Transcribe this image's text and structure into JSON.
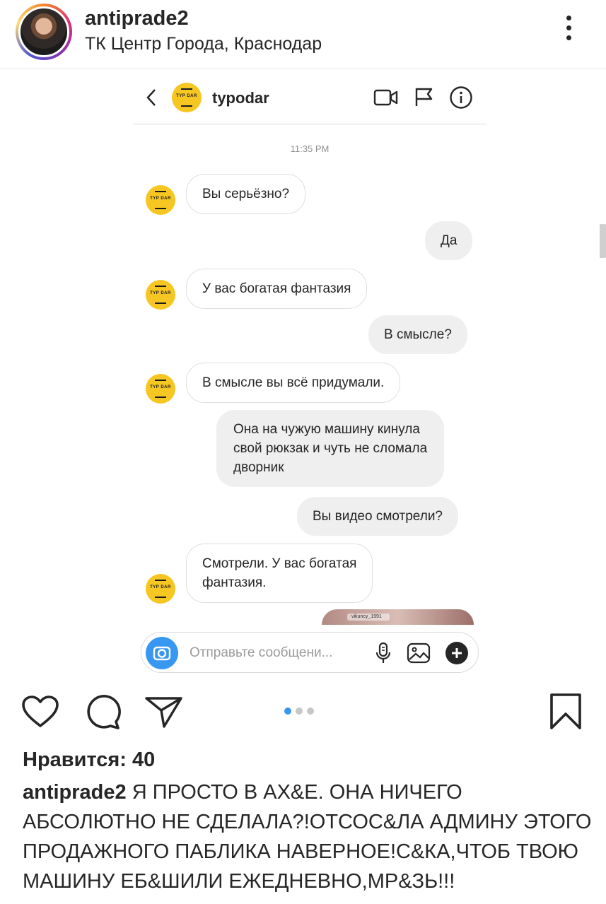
{
  "post": {
    "username": "antiprade2",
    "location": "ТК Центр Города, Краснодар"
  },
  "dm": {
    "contact_name": "typodar",
    "logo_text": "TYP DAR",
    "timestamp": "11:35 PM",
    "messages": [
      {
        "from": "them",
        "text": "Вы серьёзно?"
      },
      {
        "from": "me",
        "text": "Да"
      },
      {
        "from": "them",
        "text": "У вас богатая фантазия"
      },
      {
        "from": "me",
        "text": "В смысле?"
      },
      {
        "from": "them",
        "text": "В смысле вы всё придумали."
      },
      {
        "from": "me",
        "lines": [
          "Она на чужую машину кинула",
          "свой рюкзак и чуть не сломала",
          "дворник"
        ]
      },
      {
        "from": "me",
        "text": "Вы видео смотрели?"
      },
      {
        "from": "them",
        "lines": [
          "Смотрели. У вас богатая",
          "фантазия."
        ]
      }
    ],
    "media_tag": "vikuncy_1991",
    "composer_placeholder": "Отправьте сообщени..."
  },
  "carousel": {
    "count": 3,
    "active": 1
  },
  "likes_label": "Нравится: 40",
  "caption": {
    "username": "antiprade2",
    "text": " Я ПРОСТО В АХ&Е. ОНА НИЧЕГО АБСОЛЮТНО НЕ СДЕЛАЛА?!ОТСОС&ЛА АДМИНУ ЭТОГО ПРОДАЖНОГО ПАБЛИКА НАВЕРНОЕ!С&КА,ЧТОБ ТВОЮ МАШИНУ ЕБ&ШИЛИ ЕЖЕДНЕВНО,МР&ЗЬ!!!"
  },
  "colors": {
    "accent": "#3897f0",
    "logo_yellow": "#f6c623",
    "bubble_gray": "#efefef"
  }
}
